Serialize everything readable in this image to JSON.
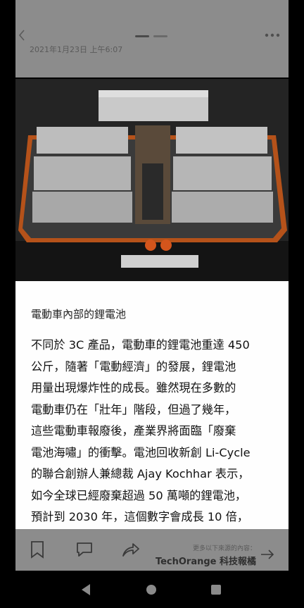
{
  "header": {
    "back_icon": "chevron-left-icon",
    "more_icon": "more-dots-icon",
    "post_date": "2021年1月23日 上午6:07"
  },
  "photo": {
    "alt_subject": "battery-pack-image"
  },
  "article": {
    "caption": "電動車內部的鋰電池",
    "lines": [
      "不同於 3C 產品，電動車的鋰電池重達 450",
      "公斤，隨著「電動經濟」的發展，鋰電池",
      "用量出現爆炸性的成長。雖然現在多數的",
      "電動車仍在「壯年」階段，但過了幾年，",
      "這些電動車報廢後，產業界將面臨「廢棄",
      "電池海嘯」的衝擊。電池回收新創 Li-Cycle",
      "的聯合創辦人兼總裁 Ajay Kochhar 表示，",
      "如今全球已經廢棄超過 50 萬噸的鋰電池，",
      "預計到 2030 年，這個數字會成長 10 倍，"
    ]
  },
  "toolbar": {
    "bookmark_icon": "bookmark-icon",
    "comment_icon": "comment-icon",
    "share_icon": "share-icon",
    "next_hint": "更多以下來源的內容：",
    "next_source": "TechOrange 科技報橘",
    "next_icon": "arrow-right-icon"
  },
  "navbar": {
    "back": "nav-back-icon",
    "home": "nav-home-icon",
    "recent": "nav-recent-icon"
  }
}
